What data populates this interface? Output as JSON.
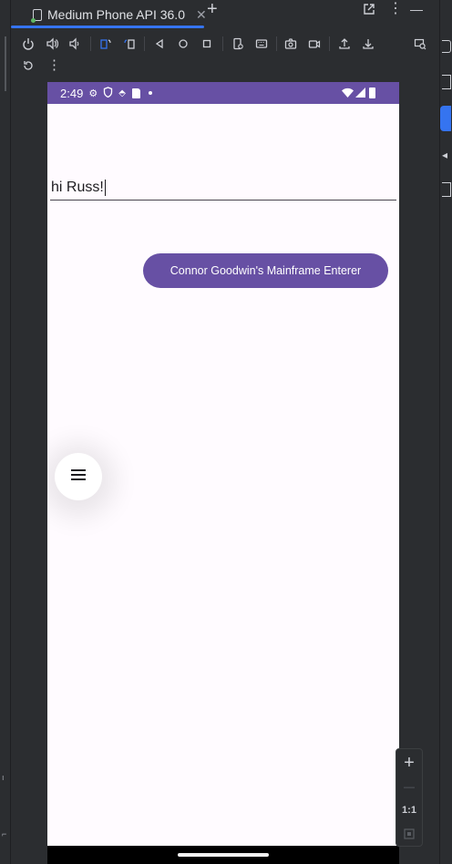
{
  "window": {
    "tab_title": "Medium Phone API 36.0",
    "add_tab": "+",
    "menu_more": "⋮",
    "minimize": "—"
  },
  "colors": {
    "ide_bg": "#2b2d30",
    "accent": "#3574f0",
    "app_primary": "#6750a4",
    "app_surface": "#fffbff"
  },
  "toolbar": {
    "icons_row1": [
      "power-icon",
      "volume-up-icon",
      "volume-down-icon",
      "rotate-left-icon",
      "rotate-right-icon",
      "back-icon",
      "home-icon",
      "overview-icon",
      "device-settings-icon",
      "keyboard-icon",
      "screenshot-icon",
      "screen-record-icon",
      "upload-icon",
      "download-icon",
      "inspect-icon"
    ],
    "icons_row2": [
      "reset-icon",
      "more-icon"
    ],
    "more_label": "⋮"
  },
  "device": {
    "status_time": "2:49",
    "status_icons": [
      "settings-icon",
      "shield-icon",
      "vpn-icon",
      "sd-card-icon",
      "dot-icon"
    ],
    "status_right": [
      "wifi-icon",
      "signal-icon",
      "battery-icon"
    ]
  },
  "app": {
    "text_field_value": "hi Russ!",
    "button_label": "Connor Goodwin's Mainframe Enterer",
    "fab_icon": "menu-icon"
  },
  "zoom": {
    "zoom_in": "+",
    "zoom_out": "—",
    "actual_size": "1:1",
    "fit_icon": "fit-screen-icon"
  }
}
